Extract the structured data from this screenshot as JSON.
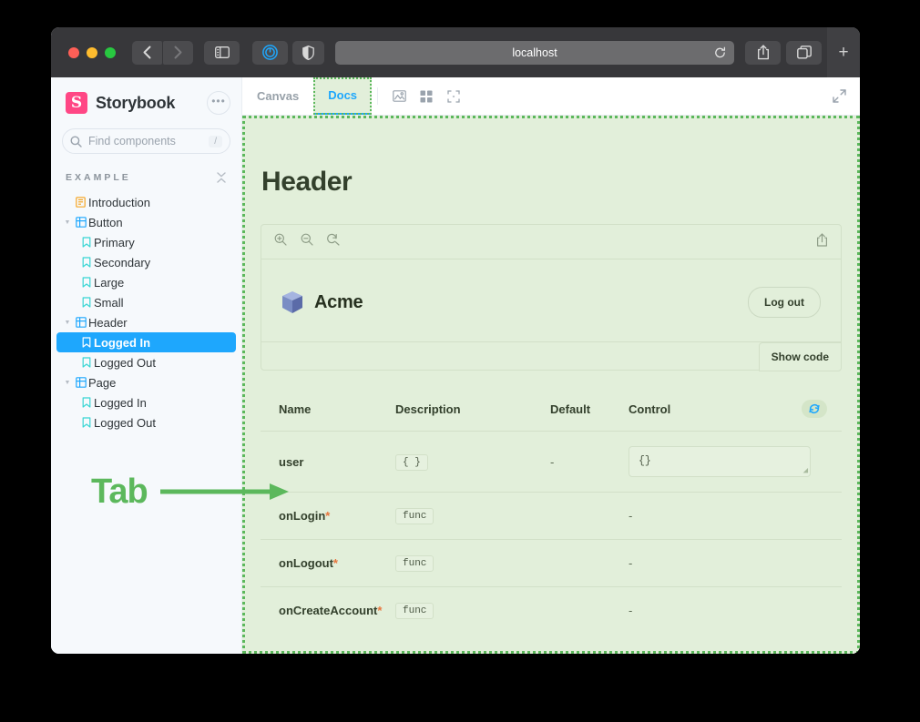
{
  "browser": {
    "url": "localhost",
    "back_icon": "chevron-left-icon",
    "forward_icon": "chevron-right-icon",
    "sidebar_icon": "sidebar-toggle-icon",
    "reader_icon": "reader-mode-icon",
    "shield_icon": "privacy-shield-icon",
    "reload_icon": "reload-icon",
    "share_icon": "share-icon",
    "tabs_icon": "tab-overview-icon",
    "newtab_label": "+"
  },
  "sidebar": {
    "brand": {
      "logo_letter": "S",
      "title": "Storybook"
    },
    "menu_label": "•••",
    "search": {
      "placeholder": "Find components",
      "shortcut": "/"
    },
    "section": {
      "label": "EXAMPLE",
      "collapse_icon": "collapse-all-icon"
    },
    "tree": [
      {
        "label": "Introduction",
        "depth": 0,
        "icon": "document-icon",
        "expandable": false,
        "selected": false
      },
      {
        "label": "Button",
        "depth": 0,
        "icon": "component-icon",
        "expandable": true,
        "selected": false
      },
      {
        "label": "Primary",
        "depth": 1,
        "icon": "story-icon",
        "expandable": false,
        "selected": false
      },
      {
        "label": "Secondary",
        "depth": 1,
        "icon": "story-icon",
        "expandable": false,
        "selected": false
      },
      {
        "label": "Large",
        "depth": 1,
        "icon": "story-icon",
        "expandable": false,
        "selected": false
      },
      {
        "label": "Small",
        "depth": 1,
        "icon": "story-icon",
        "expandable": false,
        "selected": false
      },
      {
        "label": "Header",
        "depth": 0,
        "icon": "component-icon",
        "expandable": true,
        "selected": false
      },
      {
        "label": "Logged In",
        "depth": 1,
        "icon": "story-icon",
        "expandable": false,
        "selected": true
      },
      {
        "label": "Logged Out",
        "depth": 1,
        "icon": "story-icon",
        "expandable": false,
        "selected": false
      },
      {
        "label": "Page",
        "depth": 0,
        "icon": "component-icon",
        "expandable": true,
        "selected": false
      },
      {
        "label": "Logged In",
        "depth": 1,
        "icon": "story-icon",
        "expandable": false,
        "selected": false
      },
      {
        "label": "Logged Out",
        "depth": 1,
        "icon": "story-icon",
        "expandable": false,
        "selected": false
      }
    ]
  },
  "tabbar": {
    "tabs": [
      {
        "label": "Canvas",
        "active": false
      },
      {
        "label": "Docs",
        "active": true
      }
    ],
    "tools": [
      {
        "icon": "background-image-icon"
      },
      {
        "icon": "grid-icon"
      },
      {
        "icon": "measure-icon"
      }
    ],
    "expand_icon": "expand-fullscreen-icon"
  },
  "doc": {
    "title": "Header",
    "preview": {
      "toolbar": {
        "zoom_in_icon": "zoom-in-icon",
        "zoom_out_icon": "zoom-out-icon",
        "zoom_reset_icon": "zoom-reset-icon",
        "share_icon": "share-story-icon"
      },
      "brand_name": "Acme",
      "brand_icon": "acme-cube-icon",
      "logout_label": "Log out",
      "show_code_label": "Show code"
    },
    "args_table": {
      "headers": {
        "name": "Name",
        "description": "Description",
        "default": "Default",
        "control": "Control",
        "reset_icon": "reset-controls-icon"
      },
      "rows": [
        {
          "name": "user",
          "required": "",
          "type": "{ }",
          "default": "-",
          "control_kind": "textarea",
          "control_value": "{}"
        },
        {
          "name": "onLogin",
          "required": "*",
          "type": "func",
          "default": "",
          "control_kind": "dash",
          "control_value": "-"
        },
        {
          "name": "onLogout",
          "required": "*",
          "type": "func",
          "default": "",
          "control_kind": "dash",
          "control_value": "-"
        },
        {
          "name": "onCreateAccount",
          "required": "*",
          "type": "func",
          "default": "",
          "control_kind": "dash",
          "control_value": "-"
        }
      ]
    }
  },
  "annotation": {
    "label": "Tab",
    "arrow_icon": "arrow-right-icon",
    "color": "#5cb85c"
  },
  "colors": {
    "accent_blue": "#1ea7fd",
    "brand_pink": "#ff4785",
    "highlight_green": "#5cb85c",
    "highlight_fill": "#e2efda",
    "required_orange": "#e8743b"
  }
}
